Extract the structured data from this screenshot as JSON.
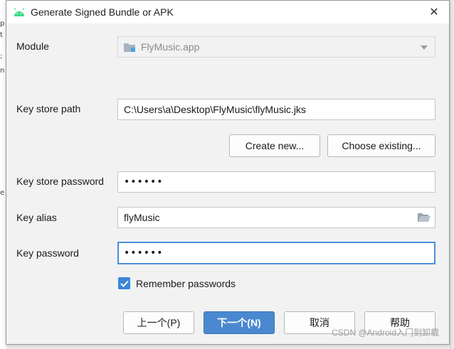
{
  "window": {
    "title": "Generate Signed Bundle or APK",
    "close_glyph": "✕"
  },
  "module": {
    "label": "Module",
    "value": "FlyMusic.app"
  },
  "key_store_path": {
    "label": "Key store path",
    "value": "C:\\Users\\a\\Desktop\\FlyMusic\\flyMusic.jks"
  },
  "key_store_buttons": {
    "create_new": "Create new...",
    "choose_existing": "Choose existing..."
  },
  "key_store_password": {
    "label": "Key store password",
    "value": "••••••"
  },
  "key_alias": {
    "label": "Key alias",
    "value": "flyMusic"
  },
  "key_password": {
    "label": "Key password",
    "value": "••••••"
  },
  "remember": {
    "label": "Remember passwords",
    "checked": true
  },
  "footer": {
    "previous": "上一个(P)",
    "next": "下一个(N)",
    "cancel": "取消",
    "help": "帮助"
  },
  "watermark": "CSDN @Android入门到卸载",
  "colors": {
    "accent": "#4a88cf",
    "focus_border": "#4a90d9",
    "android_green": "#3ddc84"
  }
}
